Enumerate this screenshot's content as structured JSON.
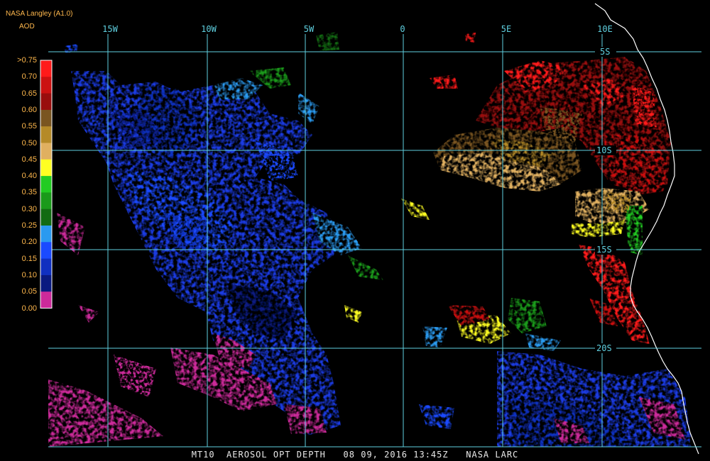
{
  "header": {
    "source": "NASA Langley (A1.0)",
    "field": "AOD"
  },
  "legend": {
    "labels": [
      ">0.75",
      "0.70",
      "0.65",
      "0.60",
      "0.55",
      "0.50",
      "0.45",
      "0.40",
      "0.35",
      "0.30",
      "0.25",
      "0.20",
      "0.15",
      "0.10",
      "0.05",
      "0.00"
    ],
    "colors": [
      "#ff1a1a",
      "#cc1111",
      "#990d0d",
      "#7a5520",
      "#b58a28",
      "#e0b060",
      "#ffff22",
      "#22cc22",
      "#1a9a1a",
      "#126b12",
      "#2a9af0",
      "#1a4aff",
      "#1030c0",
      "#0a1a80",
      "#cc2a9a",
      "#ffffff"
    ]
  },
  "map": {
    "lon_labels": [
      "15W",
      "10W",
      "5W",
      "0",
      "5E",
      "10E"
    ],
    "lat_labels": [
      "5S",
      "10S",
      "15S",
      "20S"
    ],
    "grid_color": "#5fd0e0",
    "coast_color": "#ffffff"
  },
  "footer": {
    "text": "MT10  AEROSOL OPT DEPTH   08 09, 2016 13:45Z   NASA LARC"
  }
}
